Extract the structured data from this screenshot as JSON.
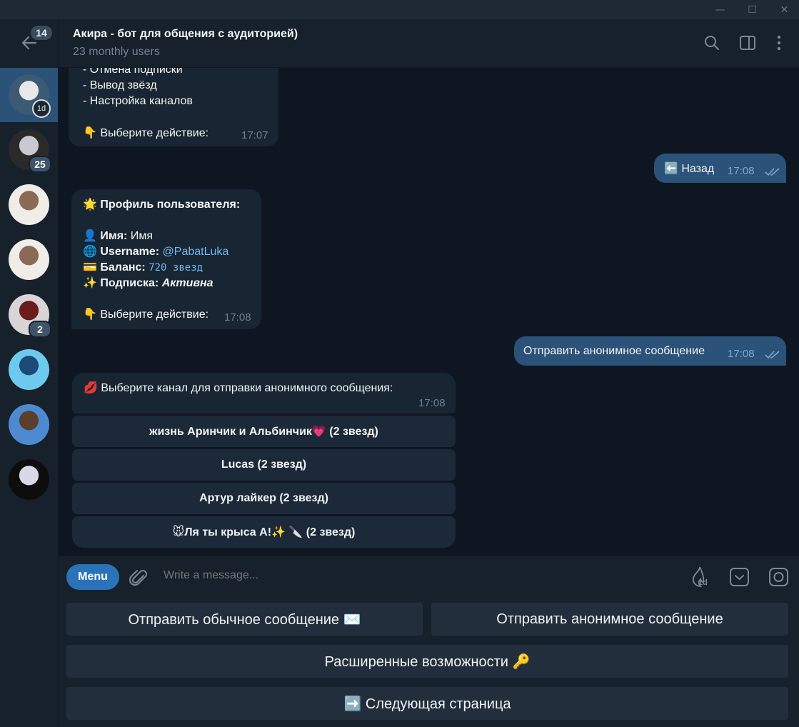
{
  "window": {
    "minimize_glyph": "—",
    "maximize_glyph": "☐",
    "close_glyph": "✕"
  },
  "sidebar": {
    "unread_counter": "14",
    "chats": [
      {
        "name": "chat-akira",
        "active": true,
        "story_badge": "1d",
        "colors": [
          "#3c5a74",
          "#e8e8e8"
        ]
      },
      {
        "name": "chat-2",
        "badge": "25",
        "colors": [
          "#2a2a2a",
          "#c9c9cf"
        ]
      },
      {
        "name": "chat-3",
        "colors": [
          "#f0ece8",
          "#8a6a56"
        ]
      },
      {
        "name": "chat-4",
        "colors": [
          "#f0ece8",
          "#8a6a56"
        ]
      },
      {
        "name": "chat-5",
        "badge": "2",
        "colors": [
          "#d9d4d6",
          "#6b1c1c"
        ]
      },
      {
        "name": "chat-6",
        "colors": [
          "#6ec9ef",
          "#1e4a78"
        ]
      },
      {
        "name": "chat-7",
        "colors": [
          "#4d8bd0",
          "#5a3f2c"
        ]
      },
      {
        "name": "chat-8",
        "colors": [
          "#0d0d0d",
          "#d8d8e8"
        ]
      }
    ]
  },
  "header": {
    "title": "Акира - бот для общения с аудиторией)",
    "subtitle": "23 monthly users"
  },
  "messages": {
    "menu_list": {
      "lines": [
        "- Отмена подписки",
        "- Вывод звёзд",
        "- Настройка каналов"
      ],
      "prompt_emoji": "👇",
      "prompt": "Выберите действие:",
      "time": "17:07"
    },
    "back_out": {
      "emoji": "⬅️",
      "text": "Назад",
      "time": "17:08"
    },
    "profile": {
      "title_emoji": "🌟",
      "title": "Профиль пользователя:",
      "name_emoji": "👤",
      "name_label": "Имя:",
      "name_value": "Имя",
      "username_emoji": "🌐",
      "username_label": "Username:",
      "username_value": "@PabatLuka",
      "balance_emoji": "💳",
      "balance_label": "Баланс:",
      "balance_value": "720 звезд",
      "sub_emoji": "✨",
      "sub_label": "Подписка:",
      "sub_value": "Активна",
      "prompt_emoji": "👇",
      "prompt": "Выберите действие:",
      "time": "17:08"
    },
    "anon_out": {
      "text": "Отправить анонимное сообщение",
      "time": "17:08"
    },
    "channel_select": {
      "emoji": "💋",
      "text": "Выберите канал для отправки анонимного сообщения:",
      "time": "17:08",
      "buttons": [
        "жизнь Аринчик и Альбинчик💗 (2 звезд)",
        "Lucas (2 звезд)",
        "Артур лайкер (2 звезд)",
        "🐭Ля ты крыса А!✨ 🔪 (2 звезд)"
      ]
    }
  },
  "composer": {
    "menu_label": "Menu",
    "placeholder": "Write a message...",
    "timer_label": "1d"
  },
  "keyboard": {
    "send_normal": "Отправить обычное сообщение ✉️",
    "send_anon": "Отправить анонимное сообщение",
    "advanced": "Расширенные возможности 🔑",
    "next_page": "➡️ Следующая страница"
  },
  "colors": {
    "background": "#0e1621",
    "sidebar": "#17212b",
    "bubble_in": "#182533",
    "bubble_out": "#2b5278",
    "accent": "#2b73b8",
    "link": "#71baf2"
  }
}
